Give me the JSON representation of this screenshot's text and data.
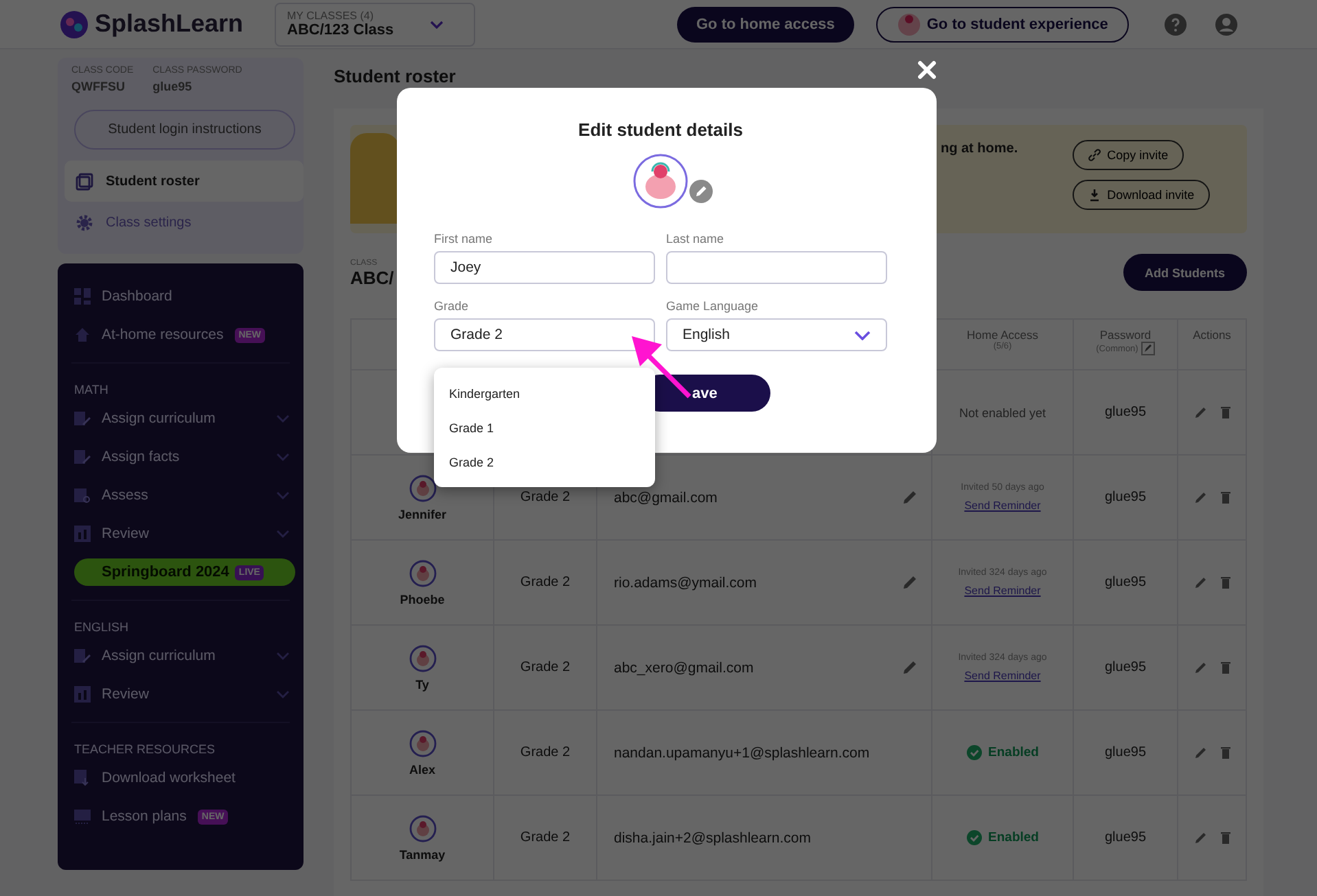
{
  "header": {
    "logo": "SplashLearn",
    "class_selector": {
      "label": "MY CLASSES (4)",
      "value": "ABC/123 Class"
    },
    "buttons": [
      {
        "label": "Go to home access",
        "kind": "primary"
      },
      {
        "label": "Go to student experience",
        "kind": "outline"
      }
    ]
  },
  "sidebar": {
    "class_code_label": "CLASS CODE",
    "class_code": "QWFFSU",
    "class_password_label": "CLASS PASSWORD",
    "class_password": "glue95",
    "login_button": "Student login instructions",
    "class_nav": [
      {
        "label": "Student roster",
        "kind": "roster",
        "selected": true
      },
      {
        "label": "Class settings",
        "kind": "settings",
        "selected": false
      }
    ],
    "nav": [
      {
        "label": "Dashboard",
        "kind": "dashboard"
      },
      {
        "label": "At-home resources",
        "kind": "home",
        "badge": "NEW"
      }
    ],
    "sections": [
      {
        "title": "MATH",
        "items": [
          {
            "label": "Assign curriculum",
            "kind": "assign",
            "expanded": false
          },
          {
            "label": "Assign facts",
            "kind": "assign",
            "expanded": false
          },
          {
            "label": "Assess",
            "kind": "assess",
            "expanded": false
          },
          {
            "label": "Review",
            "kind": "review",
            "expanded": false
          }
        ],
        "promo": {
          "label": "Springboard 2024",
          "badge": "LIVE"
        }
      },
      {
        "title": "ENGLISH",
        "items": [
          {
            "label": "Assign curriculum",
            "kind": "assign",
            "expanded": false
          },
          {
            "label": "Review",
            "kind": "review",
            "expanded": false
          }
        ]
      },
      {
        "title": "TEACHER RESOURCES",
        "items": [
          {
            "label": "Download worksheet",
            "kind": "download"
          },
          {
            "label": "Lesson plans",
            "kind": "lessons",
            "badge": "NEW"
          }
        ]
      }
    ]
  },
  "main": {
    "title": "Student roster",
    "banner": {
      "text": "ng at home.",
      "buttons": [
        {
          "label": "Copy invite",
          "kind": "copy"
        },
        {
          "label": "Download invite",
          "kind": "download"
        }
      ]
    },
    "class_label": "CLASS",
    "class_name": "ABC/",
    "add_button": "Add Students",
    "table": {
      "columns": [
        {
          "label": "Home Access",
          "sub": "(5/6)"
        },
        {
          "label": "Password",
          "sub": "(Common)",
          "editable": true
        },
        {
          "label": "Actions"
        }
      ],
      "rows": [
        {
          "home_access": {
            "kind": "not_enabled",
            "text": "Not enabled yet"
          },
          "password": "glue95"
        },
        {
          "name": "Jennifer",
          "grade": "Grade 2",
          "email": "abc@gmail.com",
          "email_editable": true,
          "home_access": {
            "kind": "invited",
            "text": "Invited 50 days ago",
            "link": "Send Reminder"
          },
          "password": "glue95"
        },
        {
          "name": "Phoebe",
          "grade": "Grade 2",
          "email": "rio.adams@ymail.com",
          "email_editable": true,
          "home_access": {
            "kind": "invited",
            "text": "Invited 324 days ago",
            "link": "Send Reminder"
          },
          "password": "glue95"
        },
        {
          "name": "Ty",
          "grade": "Grade 2",
          "email": "abc_xero@gmail.com",
          "email_editable": true,
          "home_access": {
            "kind": "invited",
            "text": "Invited 324 days ago",
            "link": "Send Reminder"
          },
          "password": "glue95"
        },
        {
          "name": "Alex",
          "grade": "Grade 2",
          "email": "nandan.upamanyu+1@splashlearn.com",
          "email_editable": false,
          "home_access": {
            "kind": "enabled",
            "text": "Enabled"
          },
          "password": "glue95"
        },
        {
          "name": "Tanmay",
          "grade": "Grade 2",
          "email": "disha.jain+2@splashlearn.com",
          "email_editable": false,
          "home_access": {
            "kind": "enabled",
            "text": "Enabled"
          },
          "password": "glue95"
        }
      ]
    }
  },
  "modal": {
    "title": "Edit student details",
    "fields": [
      {
        "label": "First name",
        "value": "Joey",
        "kind": "text"
      },
      {
        "label": "Last name",
        "kind": "text"
      },
      {
        "label": "Grade",
        "value": "Grade 2",
        "kind": "select",
        "open": true
      },
      {
        "label": "Game Language",
        "value": "English",
        "kind": "select",
        "open": false
      }
    ],
    "dropdown": [
      {
        "label": "Kindergarten",
        "selected": false
      },
      {
        "label": "Grade 1",
        "selected": false
      },
      {
        "label": "Grade 2",
        "selected": false
      }
    ],
    "save_button": "ave"
  }
}
